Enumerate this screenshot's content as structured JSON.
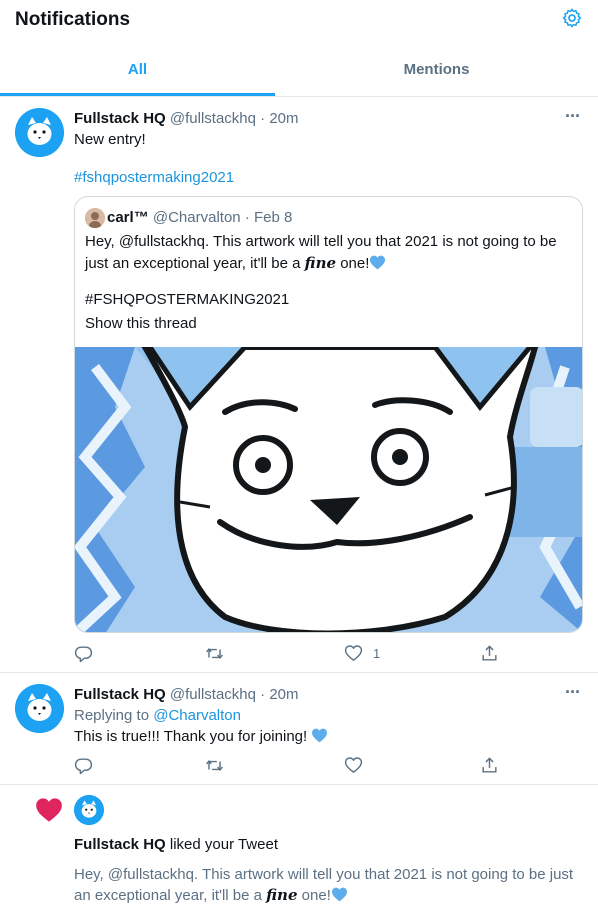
{
  "header": {
    "title": "Notifications",
    "settings_icon": "gear-icon"
  },
  "tabs": [
    {
      "label": "All",
      "active": true
    },
    {
      "label": "Mentions",
      "active": false
    }
  ],
  "tweet1": {
    "name": "Fullstack HQ",
    "handle": "@fullstackhq",
    "time": "· 20m",
    "text": "New entry!",
    "hashtag": "#fshqpostermaking2021",
    "quote": {
      "name": "carl™",
      "handle": "@Charvalton",
      "date": "· Feb 8",
      "line1": "Hey, @fullstackhq. This artwork will tell you that 2021 is not going to be",
      "line2_pre": "just an exceptional year, it'll be a ",
      "line2_fine": "fine",
      "line2_post": " one!",
      "hashtag": "#FSHQPOSTERMAKING2021",
      "show_thread": "Show this thread"
    },
    "like_count": "1"
  },
  "tweet2": {
    "name": "Fullstack HQ",
    "handle": "@fullstackhq",
    "time": "· 20m",
    "replying_label": "Replying to ",
    "replying_handle": "@Charvalton",
    "text": "This is true!!! Thank you for joining!"
  },
  "like_notification": {
    "name": "Fullstack HQ",
    "action": " liked your Tweet",
    "line1": "Hey, @fullstackhq. This artwork will tell you that 2021 is not going to be just",
    "line2_pre": "an exceptional year, it'll be a ",
    "line2_fine": "fine",
    "line2_post": " one!"
  },
  "colors": {
    "accent": "#1da1f2",
    "like": "#e0245e",
    "text_secondary": "#5b7083",
    "link": "#1b95e0"
  }
}
